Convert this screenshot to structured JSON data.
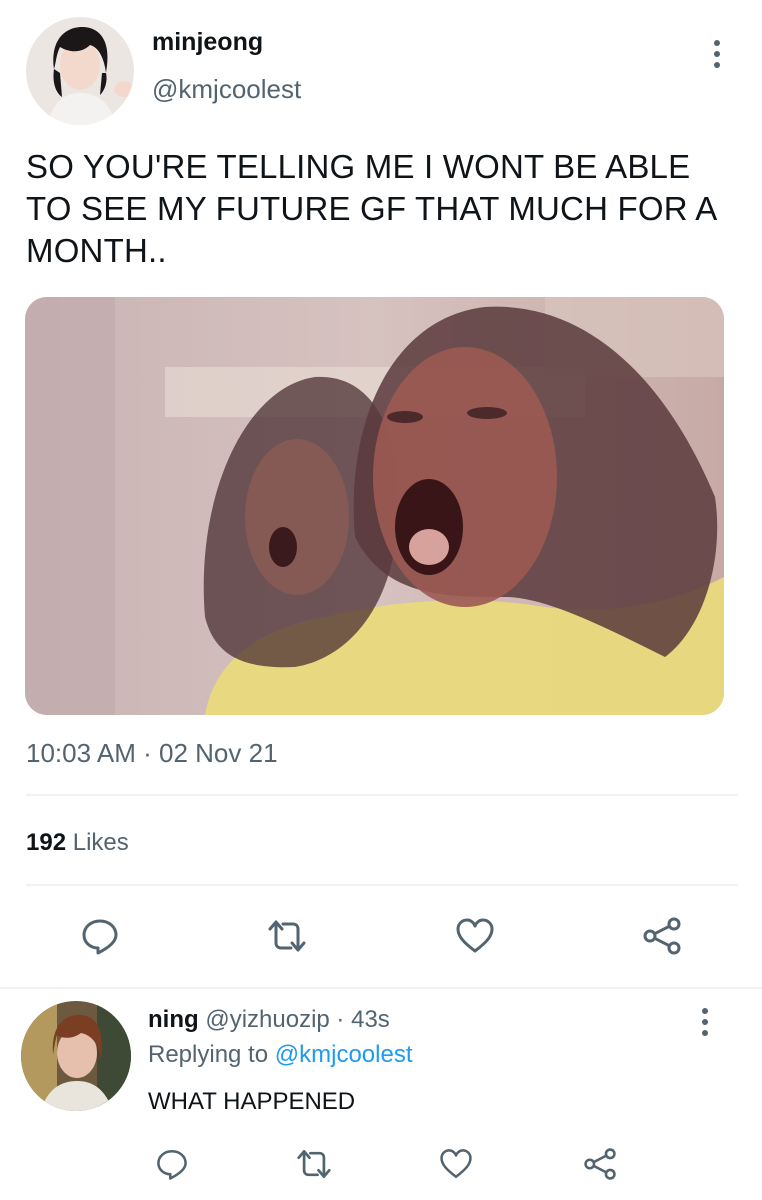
{
  "tweet": {
    "author_name": "minjeong",
    "author_handle": "@kmjcoolest",
    "text": "SO YOU'RE TELLING ME I WONT BE ABLE TO SEE MY FUTURE GF THAT MUCH FOR A MONTH..",
    "time": "10:03 AM",
    "separator": "·",
    "date": "02 Nov 21",
    "likes_count": "192",
    "likes_label": "Likes"
  },
  "reply": {
    "author_name": "ning",
    "author_handle": "@yizhuozip",
    "separator": "·",
    "age": "43s",
    "replying_prefix": "Replying to",
    "replying_to": "@kmjcoolest",
    "text": "WHAT HAPPENED"
  },
  "icons": {
    "more": "more-vertical-icon",
    "reply": "speech-bubble-icon",
    "retweet": "retweet-icon",
    "like": "heart-icon",
    "share": "share-icon"
  },
  "colors": {
    "link": "#1d9bf0",
    "secondary_text": "#536471",
    "divider": "#eff3f4"
  }
}
